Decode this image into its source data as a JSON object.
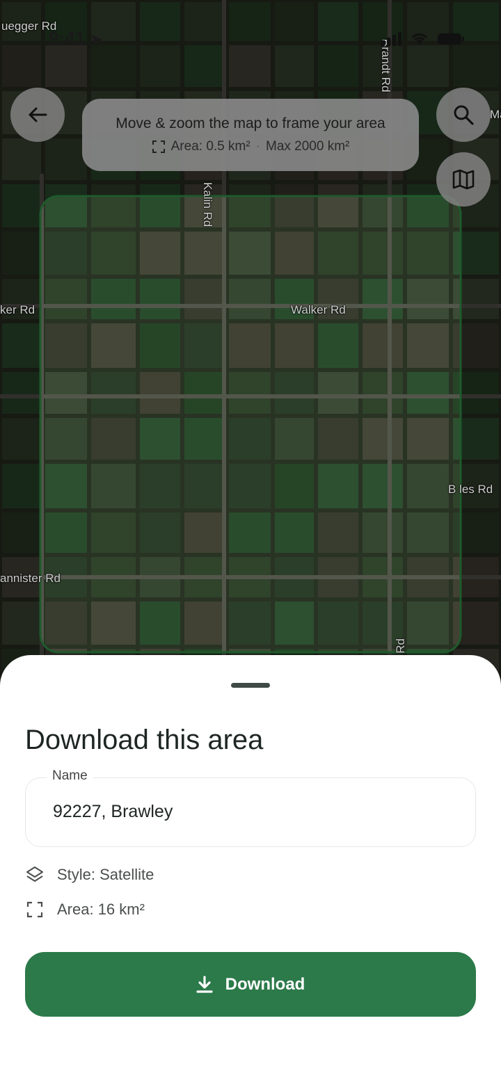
{
  "status_bar": {
    "time": "9:41"
  },
  "map": {
    "road_labels": {
      "uegger": "uegger Rd",
      "brandt": "Brandt Rd",
      "kalin": "Kalin Rd",
      "walker_left": "ker Rd",
      "walker": "Walker Rd",
      "bowles": "B les Rd",
      "bannister": "annister Rd",
      "ma": "Ma",
      "rd_bottom": "Rd"
    }
  },
  "banner": {
    "instruction": "Move & zoom the map to frame your area",
    "area": "Area: 0.5 km²",
    "separator": "·",
    "max": "Max 2000 km²"
  },
  "sheet": {
    "title": "Download this area",
    "name_label": "Name",
    "name_value": "92227, Brawley",
    "style": "Style: Satellite",
    "area": "Area: 16 km²",
    "download_label": "Download"
  },
  "colors": {
    "accent": "#2c7a4a",
    "frame": "#1f5a2c"
  }
}
